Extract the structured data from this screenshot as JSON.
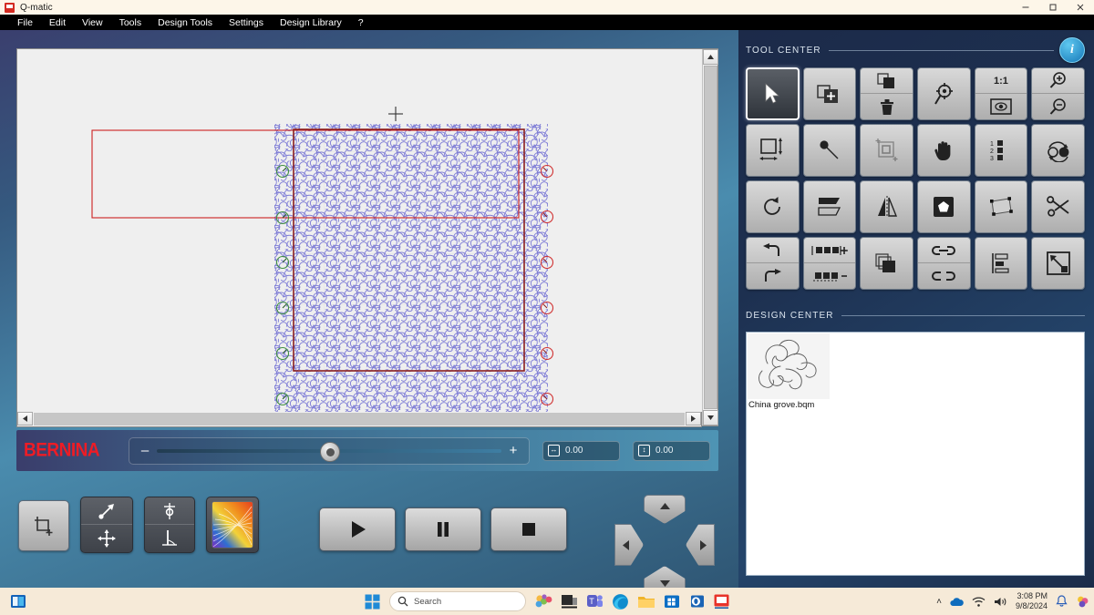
{
  "window": {
    "title": "Q-matic",
    "app_icon": "qmatic-icon",
    "controls": {
      "minimize": "─",
      "maximize": "⬜",
      "close": "✕"
    }
  },
  "menu": {
    "items": [
      "File",
      "Edit",
      "View",
      "Tools",
      "Design Tools",
      "Settings",
      "Design Library",
      "?"
    ]
  },
  "canvas": {
    "pattern_name": "quilting-swirl-pattern",
    "pattern_color": "#7d7bd6",
    "boundary_color": "#cc2020",
    "selection_color": "#8a1f1f",
    "start_marker_color": "#3f8f3f",
    "end_marker_color": "#d03030",
    "cursor": "crosshair"
  },
  "bernina_bar": {
    "logo": "BERNINA",
    "slider": {
      "minus": "–",
      "plus": "+",
      "value_pct": 47
    },
    "width_value": "0.00",
    "height_value": "0.00",
    "width_icon": "width-arrows-icon",
    "height_icon": "height-arrows-icon"
  },
  "bottom_tools": {
    "buttons": [
      {
        "name": "crop-area-button",
        "icon": "crop-plus-icon"
      },
      {
        "name": "move-point-button",
        "top_icon": "diagonal-arrow-icon",
        "bottom_icon": "move-cross-icon"
      },
      {
        "name": "needle-position-button",
        "top_icon": "needle-up-icon",
        "bottom_icon": "needle-down-icon"
      },
      {
        "name": "pattern-preview-button",
        "icon": "rainbow-swirl-icon"
      }
    ],
    "transport": [
      {
        "name": "play-button",
        "icon": "play-icon",
        "glyph": "▶"
      },
      {
        "name": "pause-button",
        "icon": "pause-icon",
        "glyph": "▐▌"
      },
      {
        "name": "stop-button",
        "icon": "stop-icon",
        "glyph": "■"
      }
    ],
    "dpad": [
      {
        "name": "dpad-up-button",
        "icon": "chevron-up-icon",
        "glyph": "▲"
      },
      {
        "name": "dpad-left-button",
        "icon": "chevron-left-icon",
        "glyph": "◀"
      },
      {
        "name": "dpad-right-button",
        "icon": "chevron-right-icon",
        "glyph": "▶"
      },
      {
        "name": "dpad-down-button",
        "icon": "chevron-down-icon",
        "glyph": "▼"
      }
    ]
  },
  "tool_center": {
    "title": "TOOL CENTER",
    "info_label": "i",
    "tools": [
      {
        "name": "select-tool",
        "icon": "cursor-arrow-icon",
        "selected": true
      },
      {
        "name": "add-design-tool",
        "icon": "add-design-icon"
      },
      {
        "name": "copy-delete-tool",
        "top_icon": "copy-icon",
        "bottom_icon": "trash-icon"
      },
      {
        "name": "center-target-tool",
        "icon": "target-search-icon"
      },
      {
        "name": "zoom-actual-tool",
        "top_label": "1:1",
        "bottom_icon": "fit-view-icon"
      },
      {
        "name": "zoom-tool",
        "top_icon": "zoom-in-icon",
        "bottom_icon": "zoom-out-icon"
      },
      {
        "name": "resize-tool",
        "icon": "resize-arrows-icon"
      },
      {
        "name": "pin-tool",
        "icon": "pin-icon"
      },
      {
        "name": "crop-tool",
        "icon": "crop-frame-icon",
        "disabled": true
      },
      {
        "name": "pan-tool",
        "icon": "hand-icon"
      },
      {
        "name": "sequence-tool",
        "icon": "sequence-list-icon"
      },
      {
        "name": "swap-objects-tool",
        "icon": "swap-circles-icon"
      },
      {
        "name": "rotate-tool",
        "icon": "rotate-cw-icon"
      },
      {
        "name": "skew-tool",
        "icon": "skew-icon"
      },
      {
        "name": "mirror-tool",
        "icon": "mirror-icon"
      },
      {
        "name": "shape-tool",
        "icon": "pentagon-icon"
      },
      {
        "name": "reshape-tool",
        "icon": "node-edit-icon"
      },
      {
        "name": "cut-tool",
        "icon": "scissors-icon"
      },
      {
        "name": "undo-redo-tool",
        "top_icon": "undo-icon",
        "bottom_icon": "redo-icon"
      },
      {
        "name": "repeat-count-tool",
        "top_icon": "add-repeat-icon",
        "bottom_icon": "remove-repeat-icon"
      },
      {
        "name": "group-tool",
        "icon": "stack-icon"
      },
      {
        "name": "link-tool",
        "top_icon": "link-icon",
        "bottom_icon": "unlink-icon"
      },
      {
        "name": "align-tool",
        "icon": "align-left-icon"
      },
      {
        "name": "scale-tool",
        "icon": "scale-diagonal-icon"
      }
    ]
  },
  "design_center": {
    "title": "DESIGN CENTER",
    "items": [
      {
        "name": "design-china-grove",
        "label": "China grove.bqm",
        "thumb_icon": "feather-swirl-icon"
      }
    ]
  },
  "taskbar": {
    "start_icon": "windows-start-icon",
    "search_placeholder": "Search",
    "search_icon": "search-icon",
    "apps": [
      {
        "name": "taskview-icon",
        "icon": "taskview-icon"
      },
      {
        "name": "copilot-icon",
        "icon": "copilot-icon"
      },
      {
        "name": "explorer2-icon",
        "icon": "dark-window-icon"
      },
      {
        "name": "teams-icon",
        "icon": "teams-icon"
      },
      {
        "name": "edge-icon",
        "icon": "edge-icon"
      },
      {
        "name": "file-explorer-icon",
        "icon": "folder-icon"
      },
      {
        "name": "store-icon",
        "icon": "microsoft-store-icon"
      },
      {
        "name": "outlook-icon",
        "icon": "outlook-icon"
      },
      {
        "name": "qmatic-taskbar-icon",
        "icon": "qmatic-icon"
      }
    ],
    "tray": {
      "chevron": "˄",
      "icons": [
        "onedrive-icon",
        "wifi-icon",
        "volume-icon"
      ],
      "time": "3:08 PM",
      "date": "9/8/2024",
      "bell_icon": "bell-icon",
      "extra_icon": "pbi-icon"
    }
  }
}
